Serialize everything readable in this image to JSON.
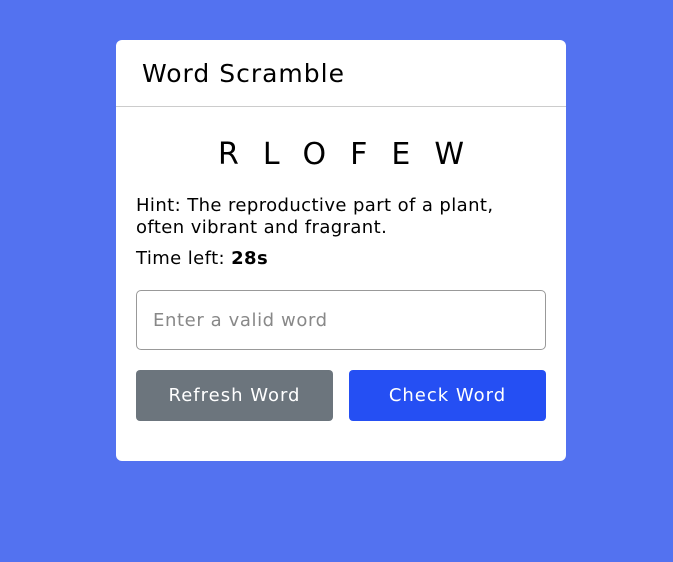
{
  "app": {
    "title": "Word Scramble"
  },
  "game": {
    "scrambled_word": "RLOFEW",
    "hint_prefix": "Hint: ",
    "hint_text": "The reproductive part of a plant, often vibrant and fragrant.",
    "time_prefix": "Time left: ",
    "time_value": "28s"
  },
  "input": {
    "value": "",
    "placeholder": "Enter a valid word"
  },
  "buttons": {
    "refresh_label": "Refresh Word",
    "check_label": "Check Word"
  },
  "colors": {
    "background": "#5372F0",
    "refresh": "#6C757D",
    "check": "#254FF3"
  }
}
